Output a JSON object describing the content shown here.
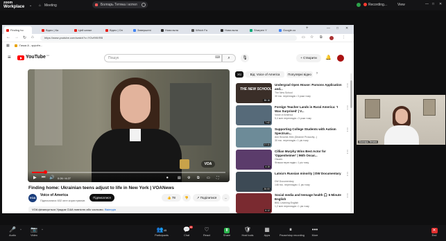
{
  "zoom": {
    "logo_line1": "zoom",
    "logo_line2": "Workplace",
    "meeting_label": "Meeting",
    "share_banner": "Болгарь Тетяна і котел",
    "recording_label": "Recording...",
    "view_label": "View",
    "camera_name": "Болгарь Тетяна",
    "toolbar": [
      {
        "label": "Audio",
        "icon": "🎤"
      },
      {
        "label": "Video",
        "icon": "📷"
      },
      {
        "label": "Participants",
        "icon": "👥",
        "count": "45"
      },
      {
        "label": "Chat",
        "icon": "💬",
        "badge": "16"
      },
      {
        "label": "React",
        "icon": "♡"
      },
      {
        "label": "Share",
        "icon": "⬆"
      },
      {
        "label": "Host tools",
        "icon": "🛡"
      },
      {
        "label": "Apps",
        "icon": "▦"
      },
      {
        "label": "Pause/stop recording",
        "icon": "⏸"
      },
      {
        "label": "More",
        "icon": "•••"
      },
      {
        "label": "End",
        "icon": "✕"
      }
    ]
  },
  "browser": {
    "tabs": [
      "Finding ho",
      "Відео | Ка",
      "Цей канал",
      "Відео | Ол",
      "Завершені",
      "Нова вкла",
      "Which Fa",
      "Нова вкла",
      "Sharpen Y",
      "Google.co"
    ],
    "url": "https://www.youtube.com/watch?v=YGvf99XRB",
    "bookmark": "Гачки.А - кручён..."
  },
  "youtube": {
    "brand": "YouTube",
    "brand_suffix": "UA",
    "search_placeholder": "Пошук",
    "create_label": "+ Створити",
    "video": {
      "title": "Finding home: Ukrainian teens adjust to life in New York | VOANews",
      "time": "0:26 / 6:27",
      "progress_fraction": 0.07,
      "watermark": "VOA"
    },
    "channel": {
      "avatar_text": "VOA",
      "name": "Voice of America",
      "subs": "Підписалися 632 млн користувачів",
      "subscribe_label": "Підписатися"
    },
    "actions": {
      "likes": "78",
      "share_label": "Поділитися",
      "more": "..."
    },
    "description": {
      "text": "VOA фінансується Урядом США повністю або частково.",
      "link": "Вікіпедія"
    },
    "chips": [
      {
        "label": "Усі",
        "active": true
      },
      {
        "label": "Від: Voice of America",
        "active": false
      },
      {
        "label": "Популярні відео",
        "active": false
      }
    ],
    "recommendations": [
      {
        "title": "Undergrad Open House: Parsons Application and...",
        "channel": "The New School",
        "meta": "30 тис. переглядів • 3 роки тому",
        "duration": "38:16",
        "color": "#3a2e28"
      },
      {
        "title": "Foreign Teacher Lands in Rural America: 'I Was Surprised' | V...",
        "channel": "Voice of America",
        "meta": "5,4 млн переглядів • 3 роки тому",
        "duration": "7:42",
        "color": "#566a79"
      },
      {
        "title": "Supporting College Students with Autism Spectrum...",
        "channel": "Ann Broome-Shin (Deanne Prosocity...)",
        "meta": "30 тис. переглядів • 1 рік тому",
        "duration": "17:11",
        "color": "#6d8b98"
      },
      {
        "title": "Cillian Murphy Wins Best Actor for 'Oppenheimer' | 96th Oscar...",
        "channel": "Oscars",
        "meta": "Фільми переглядів • 1 рік тому",
        "duration": "4:15",
        "color": "#5b3c6b"
      },
      {
        "title": "Latvia's Russian minority | DW Documentary",
        "channel": "DW Documentary",
        "meta": "146 тис. переглядів • 1 рік тому",
        "duration": "26:00",
        "color": "#3d4a55"
      },
      {
        "title": "Social media and teenage health 🎧 6 Minute English",
        "channel": "BBC Learning English",
        "meta": "1,2 млн переглядів • 1 рік тому",
        "duration": "6:12",
        "color": "#7a2a30"
      }
    ]
  }
}
